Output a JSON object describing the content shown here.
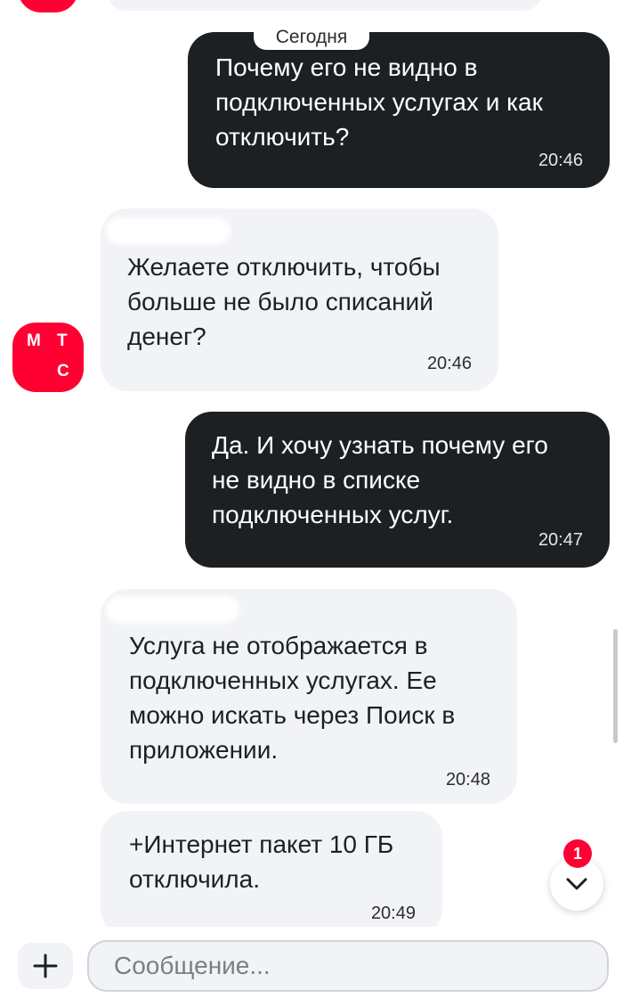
{
  "chat": {
    "date_divider": "Сегодня",
    "messages": [
      {
        "direction": "out",
        "text": "Почему его не видно в\nподключенных услугах и как\nотключить?",
        "time": "20:46"
      },
      {
        "direction": "in",
        "text": "Желаете отключить, чтобы\nбольше не было списаний\nденег?",
        "time": "20:46"
      },
      {
        "direction": "out",
        "text": "Да. И хочу узнать почему его\nне видно в списке\nподключенных услуг.",
        "time": "20:47"
      },
      {
        "direction": "in",
        "text": "Услуга не отображается в\nподключенных услугах. Ее\nможно искать через Поиск в\nприложении.",
        "time": "20:48"
      },
      {
        "direction": "in",
        "text": "+Интернет пакет 10 ГБ\nотключила.",
        "time": "20:49"
      }
    ]
  },
  "avatar": {
    "letters": [
      "М",
      "Т",
      "С"
    ],
    "color": "#ff0032"
  },
  "scroll_down": {
    "icon": "chevron-down-icon",
    "unread_count": "1"
  },
  "composer": {
    "placeholder": "Сообщение...",
    "value": "",
    "attach_icon": "plus-icon"
  },
  "colors": {
    "accent": "#ff0032",
    "outgoing_bubble": "#1d2023",
    "incoming_bubble": "#f2f3f7"
  }
}
